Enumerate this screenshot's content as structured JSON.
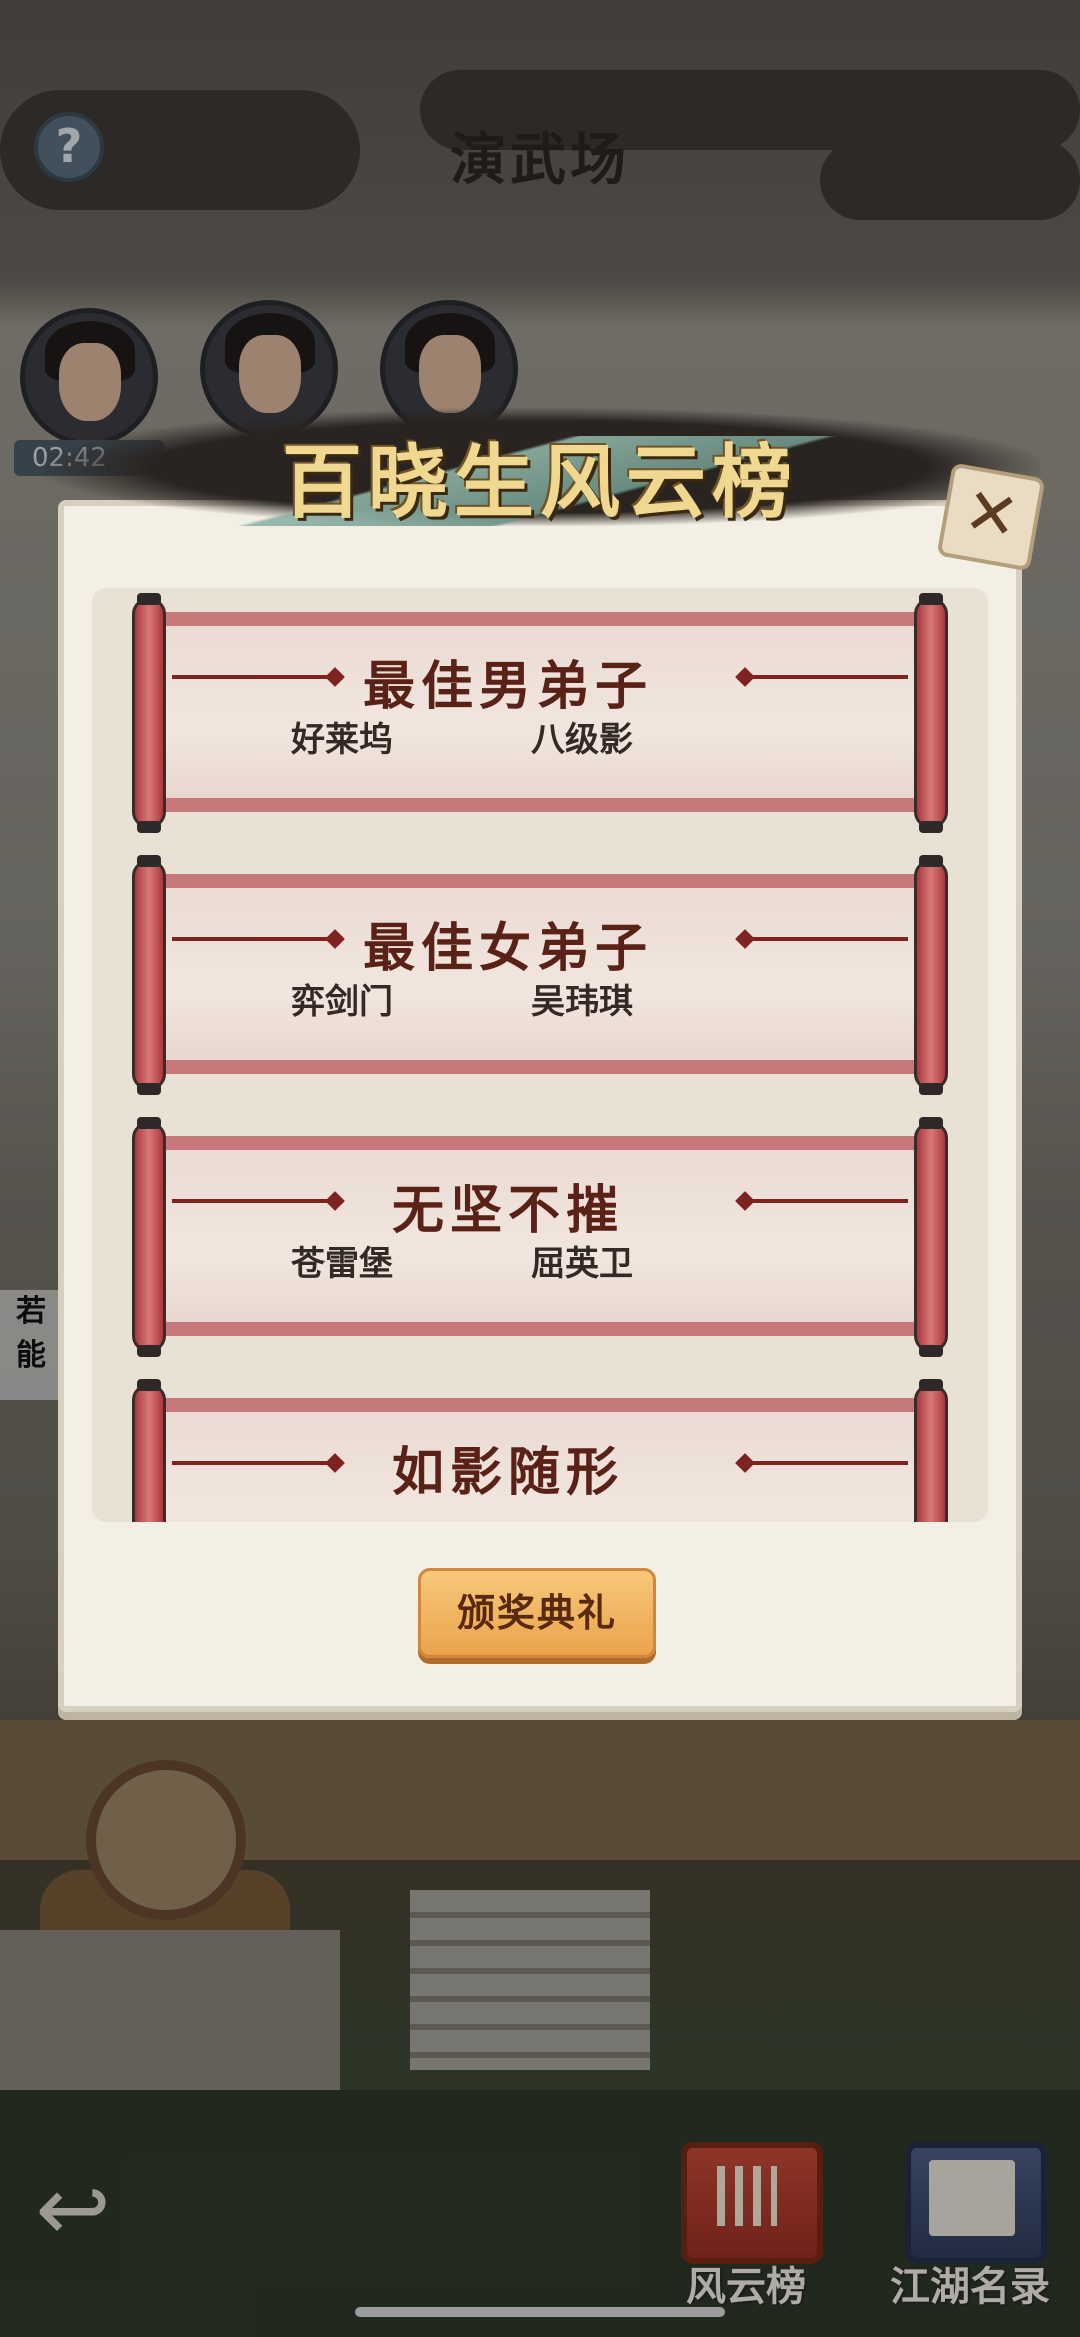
{
  "header": {
    "title": "演武场",
    "help_icon": "?"
  },
  "timer": {
    "text": "02:42"
  },
  "side_text": {
    "line1": "若",
    "line2": "能"
  },
  "modal": {
    "title": "百晓生风云榜",
    "close_icon": "✕",
    "awards": [
      {
        "title": "最佳男弟子",
        "winners": [
          "好莱坞",
          "八级影"
        ]
      },
      {
        "title": "最佳女弟子",
        "winners": [
          "弈剑门",
          "吴玮琪"
        ]
      },
      {
        "title": "无坚不摧",
        "winners": [
          "苍雷堡",
          "屈英卫"
        ]
      },
      {
        "title": "如影随形",
        "winners": [
          "",
          ""
        ]
      }
    ],
    "ceremony_button": "颁奖典礼"
  },
  "bottom": {
    "back_icon": "↩",
    "rank_button": "风云榜",
    "directory_button": "江湖名录"
  }
}
